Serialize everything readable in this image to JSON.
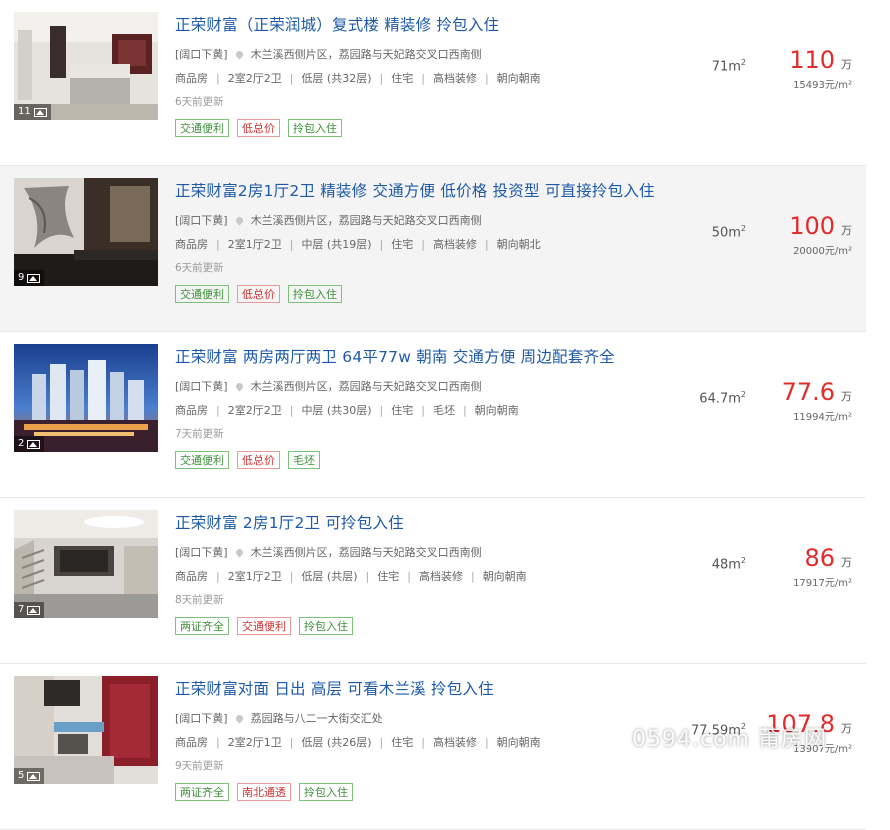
{
  "listings": [
    {
      "title": "正荣财富（正荣润城）复式楼 精装修 拎包入住",
      "district": "[阔口下黄]",
      "address": "木兰溪西侧片区，荔园路与天妃路交叉口西南侧",
      "attrs": [
        "商品房",
        "2室2厅2卫",
        "低层 (共32层)",
        "住宅",
        "高档装修",
        "朝向朝南"
      ],
      "time": "6天前更新",
      "tags": [
        {
          "text": "交通便利",
          "style": "green"
        },
        {
          "text": "低总价",
          "style": "red"
        },
        {
          "text": "拎包入住",
          "style": "green"
        }
      ],
      "photo_count": "11",
      "area_value": "71m",
      "area_sup": "2",
      "price": "110",
      "price_unit": "万",
      "price_per": "15493元/m²",
      "image": "kitchen"
    },
    {
      "title": "正荣财富2房1厅2卫 精装修 交通方便 低价格 投资型 可直接拎包入住",
      "district": "[阔口下黄]",
      "address": "木兰溪西侧片区，荔园路与天妃路交叉口西南侧",
      "attrs": [
        "商品房",
        "2室1厅2卫",
        "中层 (共19层)",
        "住宅",
        "高档装修",
        "朝向朝北"
      ],
      "time": "6天前更新",
      "tags": [
        {
          "text": "交通便利",
          "style": "green"
        },
        {
          "text": "低总价",
          "style": "red"
        },
        {
          "text": "拎包入住",
          "style": "green"
        }
      ],
      "photo_count": "9",
      "area_value": "50m",
      "area_sup": "2",
      "price": "100",
      "price_unit": "万",
      "price_per": "20000元/m²",
      "image": "living"
    },
    {
      "title": "正荣财富 两房两厅两卫 64平77w 朝南 交通方便 周边配套齐全",
      "district": "[阔口下黄]",
      "address": "木兰溪西侧片区，荔园路与天妃路交叉口西南侧",
      "attrs": [
        "商品房",
        "2室2厅2卫",
        "中层 (共30层)",
        "住宅",
        "毛坯",
        "朝向朝南"
      ],
      "time": "7天前更新",
      "tags": [
        {
          "text": "交通便利",
          "style": "green"
        },
        {
          "text": "低总价",
          "style": "red"
        },
        {
          "text": "毛坯",
          "style": "green"
        }
      ],
      "photo_count": "2",
      "area_value": "64.7m",
      "area_sup": "2",
      "price": "77.6",
      "price_unit": "万",
      "price_per": "11994元/m²",
      "image": "city"
    },
    {
      "title": "正荣财富 2房1厅2卫 可拎包入住",
      "district": "[阔口下黄]",
      "address": "木兰溪西侧片区，荔园路与天妃路交叉口西南侧",
      "attrs": [
        "商品房",
        "2室1厅2卫",
        "低层 (共层)",
        "住宅",
        "高档装修",
        "朝向朝南"
      ],
      "time": "8天前更新",
      "tags": [
        {
          "text": "两证齐全",
          "style": "green"
        },
        {
          "text": "交通便利",
          "style": "red"
        },
        {
          "text": "拎包入住",
          "style": "green"
        }
      ],
      "photo_count": "7",
      "area_value": "48m",
      "area_sup": "2",
      "price": "86",
      "price_unit": "万",
      "price_per": "17917元/m²",
      "image": "duplex"
    },
    {
      "title": "正荣财富对面 日出 高层 可看木兰溪 拎包入住",
      "district": "[阔口下黄]",
      "address": "荔园路与八二一大街交汇处",
      "attrs": [
        "商品房",
        "2室2厅1卫",
        "低层 (共26层)",
        "住宅",
        "高档装修",
        "朝向朝南"
      ],
      "time": "9天前更新",
      "tags": [
        {
          "text": "两证齐全",
          "style": "green"
        },
        {
          "text": "南北通透",
          "style": "red"
        },
        {
          "text": "拎包入住",
          "style": "green"
        }
      ],
      "photo_count": "5",
      "area_value": "77.59m",
      "area_sup": "2",
      "price": "107.8",
      "price_unit": "万",
      "price_per": "13907元/m²",
      "image": "kitchen2"
    }
  ],
  "watermark": "0594.com 莆房网",
  "icons": {
    "photo": "picture-icon",
    "location": "location-pin-icon"
  },
  "colors": {
    "title": "#1e5aa8",
    "price": "#e22b2b",
    "tag_green": "#3e8f3a",
    "tag_red": "#cc3333"
  }
}
